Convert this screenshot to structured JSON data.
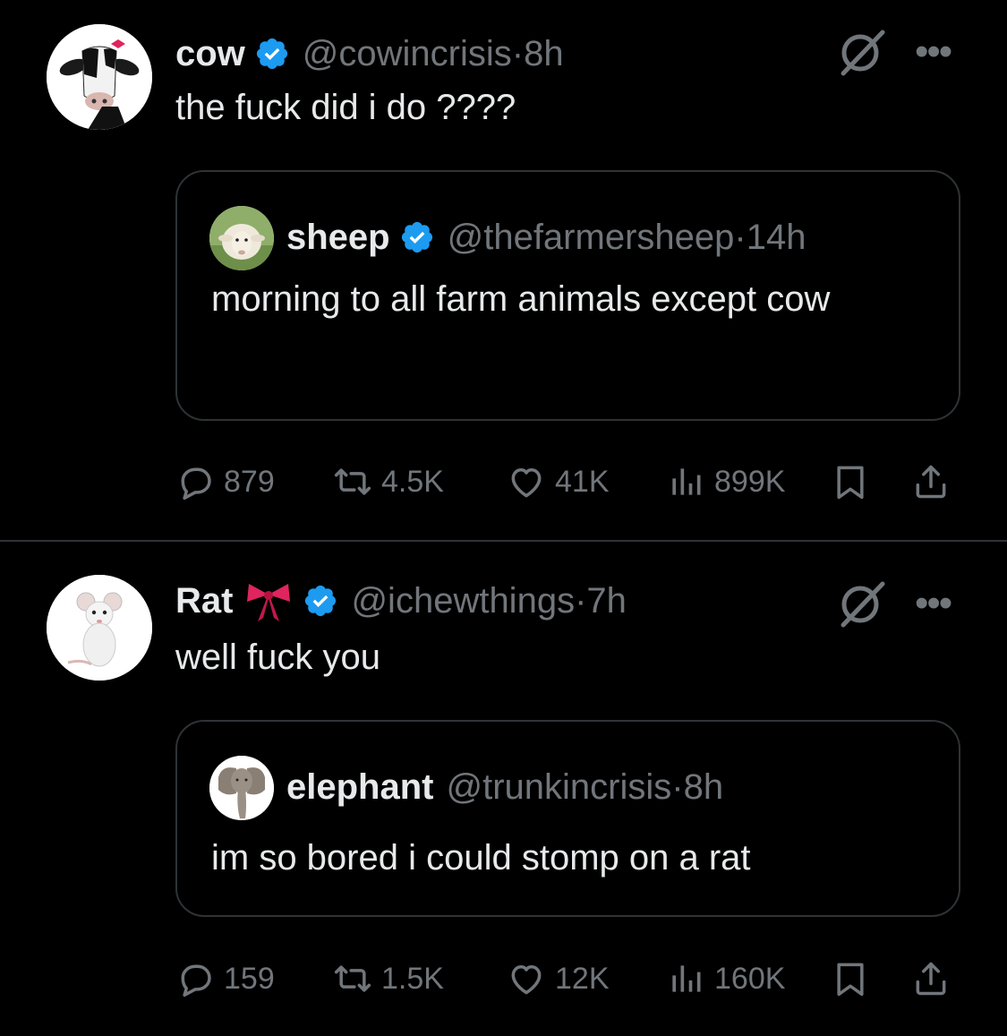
{
  "tweets": [
    {
      "author": {
        "name": "cow",
        "handle": "@cowincrisis",
        "time": "8h",
        "verified": true
      },
      "text": "the fuck did i do ????",
      "quote": {
        "author": {
          "name": "sheep",
          "handle": "@thefarmersheep",
          "time": "14h",
          "verified": true
        },
        "text": "morning to all farm animals except cow"
      },
      "stats": {
        "replies": "879",
        "reposts": "4.5K",
        "likes": "41K",
        "views": "899K"
      }
    },
    {
      "author": {
        "name": "Rat",
        "emoji": "ribbon-bow",
        "handle": "@ichewthings",
        "time": "7h",
        "verified": true
      },
      "text": "well fuck you",
      "quote": {
        "author": {
          "name": "elephant",
          "handle": "@trunkincrisis",
          "time": "8h",
          "verified": false
        },
        "text": "im so bored i could stomp on a rat"
      },
      "stats": {
        "replies": "159",
        "reposts": "1.5K",
        "likes": "12K",
        "views": "160K"
      }
    }
  ],
  "ui": {
    "separator": " · ",
    "more_glyph": "•••",
    "icons": [
      "grok-icon",
      "more-icon",
      "reply-icon",
      "repost-icon",
      "like-icon",
      "views-icon",
      "bookmark-icon",
      "share-icon",
      "verified-badge-icon"
    ],
    "colors": {
      "background": "#000000",
      "text": "#e7e9ea",
      "secondary": "#71767b",
      "border": "#2f3336",
      "verified": "#1d9bf0",
      "bow": "#e0245e"
    }
  }
}
